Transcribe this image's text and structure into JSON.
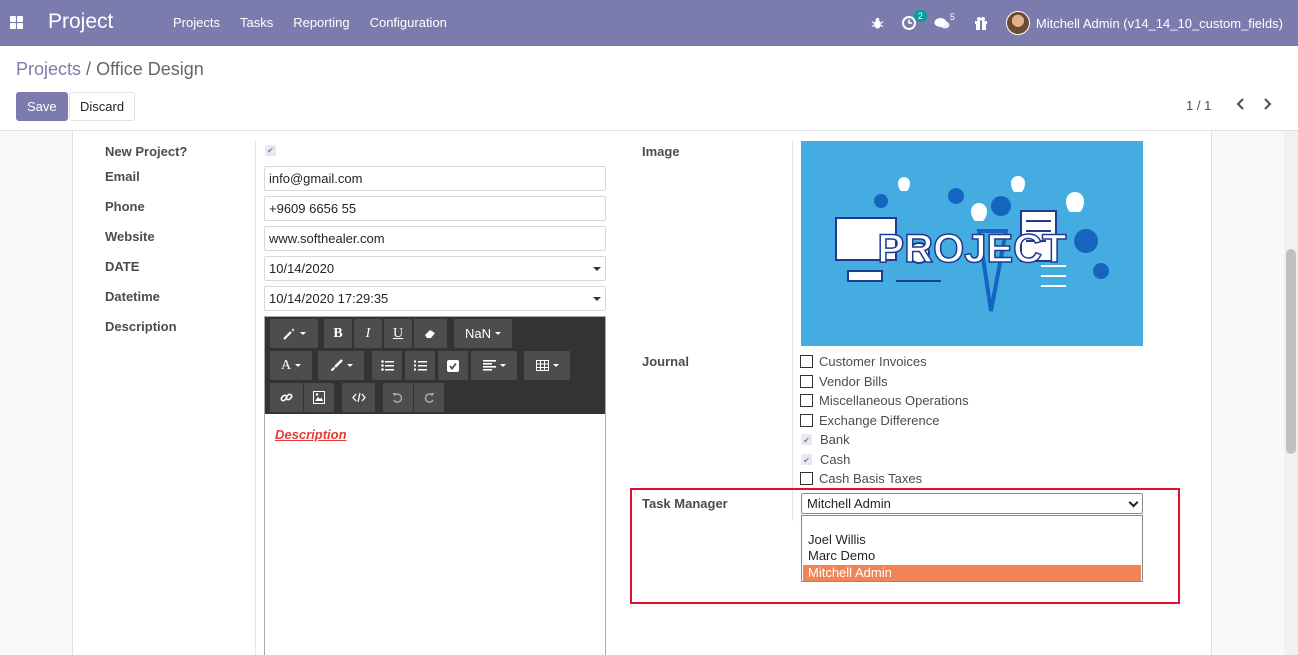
{
  "navbar": {
    "app_title": "Project",
    "menu": [
      "Projects",
      "Tasks",
      "Reporting",
      "Configuration"
    ],
    "activity_count": "2",
    "messages_count": "5",
    "user": "Mitchell Admin (v14_14_10_custom_fields)",
    "accent_color": "#7c7bad"
  },
  "breadcrumb": {
    "parent": "Projects",
    "separator": "/",
    "current": "Office Design"
  },
  "buttons": {
    "save": "Save",
    "discard": "Discard"
  },
  "pager": {
    "value": "1 / 1"
  },
  "form_left": {
    "new_project_label": "New Project?",
    "email_label": "Email",
    "email_value": "info@gmail.com",
    "phone_label": "Phone",
    "phone_value": "+9609 6656 55",
    "website_label": "Website",
    "website_value": "www.softhealer.com",
    "date_label": "DATE",
    "date_value": "10/14/2020",
    "datetime_label": "Datetime",
    "datetime_value": "10/14/2020 17:29:35",
    "description_label": "Description"
  },
  "editor": {
    "font_size": "NaN",
    "bold": "B",
    "italic": "I",
    "underline": "U",
    "font_color": "A",
    "content": "Description"
  },
  "form_right": {
    "image_label": "Image",
    "image_text": "PROJECT",
    "journal_label": "Journal",
    "journals": [
      {
        "name": "Customer Invoices",
        "checked": false
      },
      {
        "name": "Vendor Bills",
        "checked": false
      },
      {
        "name": "Miscellaneous Operations",
        "checked": false
      },
      {
        "name": "Exchange Difference",
        "checked": false
      },
      {
        "name": "Bank",
        "checked": true
      },
      {
        "name": "Cash",
        "checked": true
      },
      {
        "name": "Cash Basis Taxes",
        "checked": false
      }
    ],
    "task_manager_label": "Task Manager",
    "task_manager_value": "Mitchell Admin",
    "task_manager_options": [
      "",
      "Joel Willis",
      "Marc Demo",
      "Mitchell Admin"
    ],
    "highlight_color": "#e0112b",
    "selected_option_color": "#f08457"
  }
}
